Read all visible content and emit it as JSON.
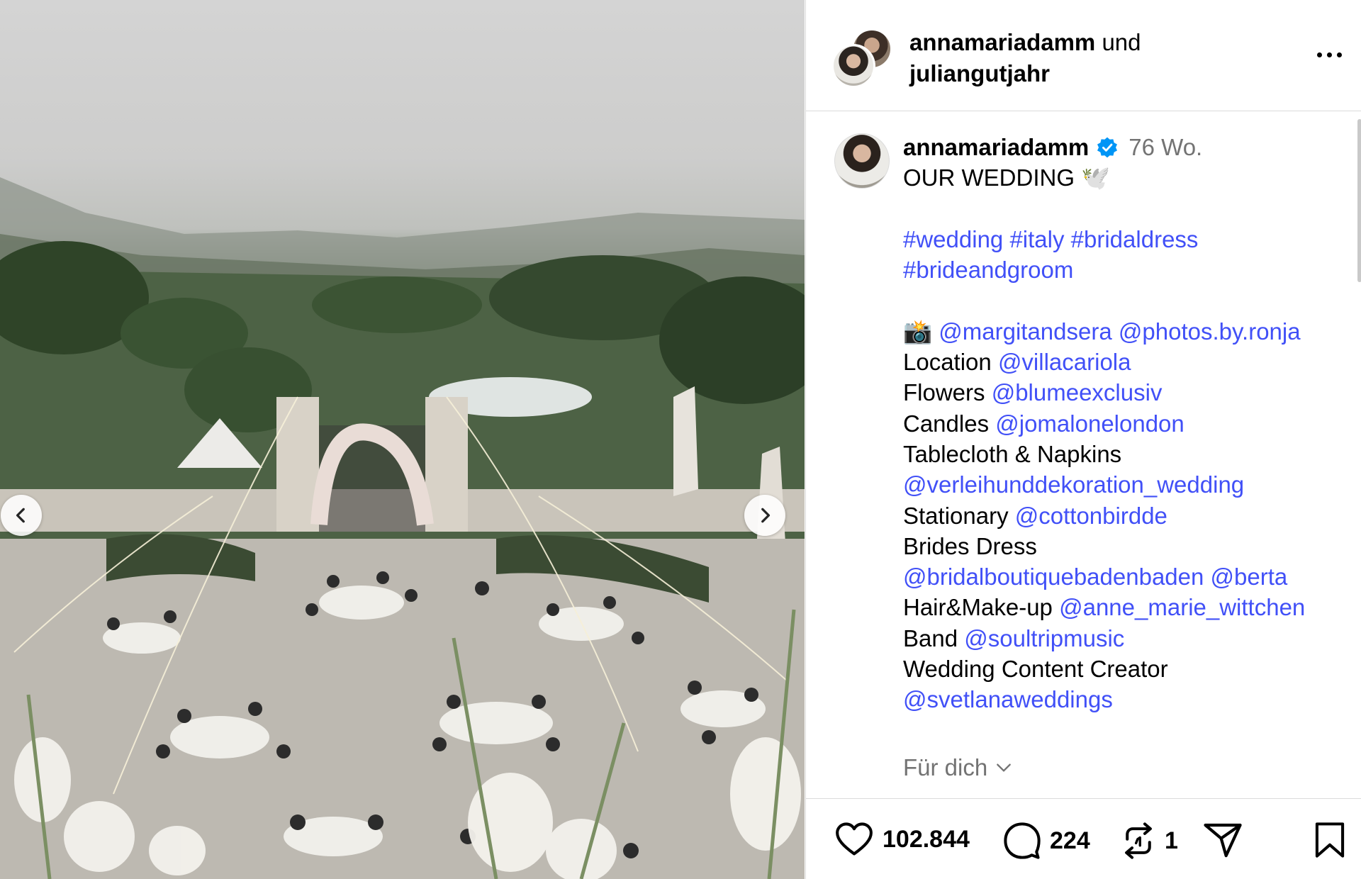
{
  "post": {
    "header": {
      "user1": "annamariadamm",
      "connector": "und",
      "user2": "juliangutjahr"
    },
    "caption": {
      "username": "annamariadamm",
      "time_ago": "76 Wo.",
      "title": "OUR WEDDING 🕊️",
      "hashtags_line1": "#wedding #italy #bridaldress",
      "hashtags_line2": "#brideandgroom",
      "camera_emoji": "📸",
      "photographer1": "@margitandsera",
      "photographer2": "@photos.by.ronja",
      "credits": [
        {
          "label": "Location",
          "handle": "@villacariola"
        },
        {
          "label": "Flowers",
          "handle": "@blumeexclusiv"
        },
        {
          "label": "Candles",
          "handle": "@jomalonelondon"
        }
      ],
      "tablecloth_label": "Tablecloth & Napkins",
      "tablecloth_handle": "@verleihunddekoration_wedding",
      "stationary_label": "Stationary",
      "stationary_handle": "@cottonbirdde",
      "dress_label": "Brides Dress",
      "dress_handle1": "@bridalboutiquebadenbaden",
      "dress_handle2": "@berta",
      "hair_label": "Hair&Make-up",
      "hair_handle": "@anne_marie_wittchen",
      "band_label": "Band",
      "band_handle": "@soultripmusic",
      "creator_label": "Wedding Content Creator",
      "creator_handle": "@svetlanaweddings"
    },
    "for_you": "Für dich",
    "actions": {
      "likes": "102.844",
      "comments": "224",
      "reposts": "1"
    },
    "icons": {
      "verified": "verified-badge-icon",
      "more": "more-options-icon",
      "like": "heart-icon",
      "comment": "comment-bubble-icon",
      "repost": "repost-icon",
      "share": "paper-plane-icon",
      "save": "bookmark-icon",
      "prev": "chevron-left-icon",
      "next": "chevron-right-icon"
    },
    "colors": {
      "link": "#4150f7",
      "secondary_text": "#737373",
      "verified": "#0095f6",
      "border": "#dbdbdb"
    }
  }
}
